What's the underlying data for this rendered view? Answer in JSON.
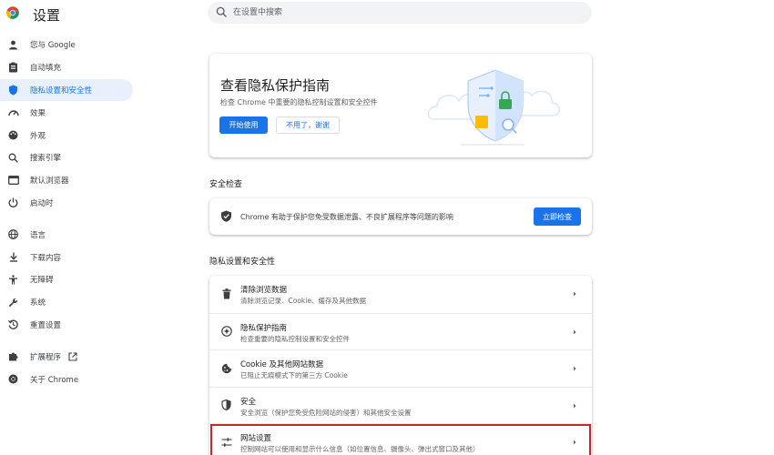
{
  "header": {
    "title": "设置",
    "search_placeholder": "在设置中搜索"
  },
  "sidebar": {
    "items": [
      {
        "label": "您与 Google",
        "icon": "person-icon"
      },
      {
        "label": "自动填充",
        "icon": "clipboard-icon"
      },
      {
        "label": "隐私设置和安全性",
        "icon": "shield-icon",
        "active": true
      },
      {
        "label": "效果",
        "icon": "speedometer-icon"
      },
      {
        "label": "外观",
        "icon": "palette-icon"
      },
      {
        "label": "搜索引擎",
        "icon": "search-icon"
      },
      {
        "label": "默认浏览器",
        "icon": "browser-icon"
      },
      {
        "label": "启动时",
        "icon": "power-icon"
      },
      {
        "label": "语言",
        "icon": "globe-icon"
      },
      {
        "label": "下载内容",
        "icon": "download-icon"
      },
      {
        "label": "无障碍",
        "icon": "accessibility-icon"
      },
      {
        "label": "系统",
        "icon": "wrench-icon"
      },
      {
        "label": "重置设置",
        "icon": "history-icon"
      },
      {
        "label": "扩展程序",
        "icon": "puzzle-icon"
      },
      {
        "label": "关于 Chrome",
        "icon": "chrome-icon"
      }
    ]
  },
  "promo": {
    "title": "查看隐私保护指南",
    "description": "检查 Chrome 中重要的隐私控制设置和安全控件",
    "start_button": "开始使用",
    "dismiss_button": "不用了，谢谢"
  },
  "safety_check": {
    "section_title": "安全检查",
    "text": "Chrome 有助于保护您免受数据泄露、不良扩展程序等问题的影响",
    "button": "立即检查"
  },
  "privacy": {
    "section_title": "隐私设置和安全性",
    "rows": [
      {
        "title": "清除浏览数据",
        "subtitle": "清除浏览记录、Cookie、缓存及其他数据",
        "icon": "trash-icon"
      },
      {
        "title": "隐私保护指南",
        "subtitle": "检查重要的隐私控制设置和安全控件",
        "icon": "compass-icon"
      },
      {
        "title": "Cookie 及其他网站数据",
        "subtitle": "已阻止无痕模式下的第三方 Cookie",
        "icon": "cookie-icon"
      },
      {
        "title": "安全",
        "subtitle": "安全浏览（保护您免受危险网站的侵害）和其他安全设置",
        "icon": "shield-icon"
      },
      {
        "title": "网站设置",
        "subtitle": "控制网站可以使用和显示什么信息（如位置信息、摄像头、弹出式窗口及其他）",
        "icon": "tune-icon",
        "highlighted": true
      }
    ]
  },
  "colors": {
    "accent": "#1a73e8",
    "active_bg": "#e8f0fe",
    "highlight": "#c62828"
  }
}
